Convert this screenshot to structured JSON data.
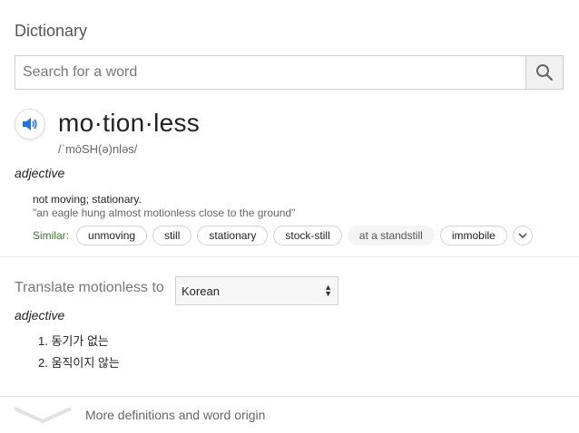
{
  "header": {
    "title": "Dictionary"
  },
  "search": {
    "placeholder": "Search for a word",
    "value": ""
  },
  "entry": {
    "word": "mo·tion·less",
    "phonetic": "/ˈmōSH(ə)nləs/",
    "part_of_speech": "adjective",
    "definition": "not moving; stationary.",
    "example": "\"an eagle hung almost motionless close to the ground\"",
    "similar_label": "Similar:",
    "similar": [
      "unmoving",
      "still",
      "stationary",
      "stock-still",
      "at a standstill",
      "immobile"
    ]
  },
  "translate": {
    "label": "Translate motionless to",
    "language": "Korean",
    "part_of_speech": "adjective",
    "items": [
      "1. 동기가 없는",
      "2. 움직이지 않는"
    ]
  },
  "footer": {
    "more_label": "More definitions and word origin"
  },
  "colors": {
    "similar_label": "#3a7d2c",
    "accent_blue": "#1a73e8"
  }
}
